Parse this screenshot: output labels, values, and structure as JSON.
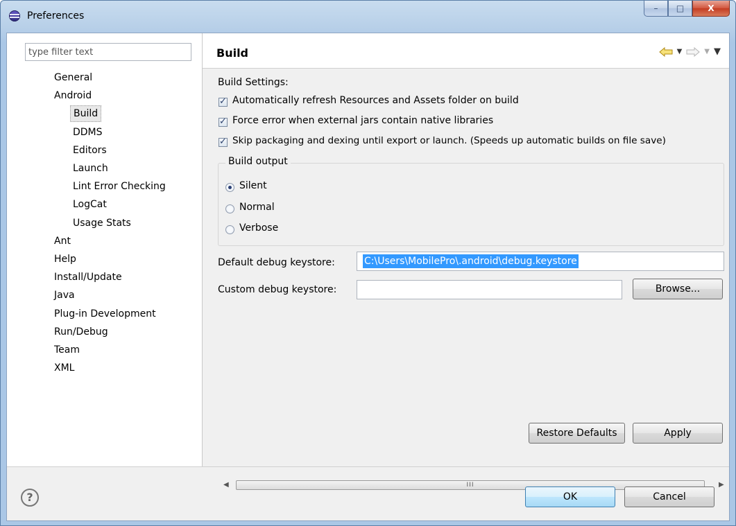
{
  "window": {
    "title": "Preferences",
    "minimize": "–",
    "maximize": "□",
    "close": "X"
  },
  "filter": {
    "placeholder": "type filter text"
  },
  "tree": [
    {
      "label": "General",
      "level": 0
    },
    {
      "label": "Android",
      "level": 0
    },
    {
      "label": "Build",
      "level": 1,
      "selected": true
    },
    {
      "label": "DDMS",
      "level": 1
    },
    {
      "label": "Editors",
      "level": 1
    },
    {
      "label": "Launch",
      "level": 1
    },
    {
      "label": "Lint Error Checking",
      "level": 1
    },
    {
      "label": "LogCat",
      "level": 1
    },
    {
      "label": "Usage Stats",
      "level": 1
    },
    {
      "label": "Ant",
      "level": 0
    },
    {
      "label": "Help",
      "level": 0
    },
    {
      "label": "Install/Update",
      "level": 0
    },
    {
      "label": "Java",
      "level": 0
    },
    {
      "label": "Plug-in Development",
      "level": 0
    },
    {
      "label": "Run/Debug",
      "level": 0
    },
    {
      "label": "Team",
      "level": 0
    },
    {
      "label": "XML",
      "level": 0
    }
  ],
  "page": {
    "title": "Build",
    "nav_icons": [
      "back-arrow-icon",
      "back-menu-icon",
      "forward-arrow-icon",
      "forward-menu-icon",
      "view-menu-icon"
    ],
    "settings_label": "Build Settings:",
    "checkboxes": [
      {
        "label": "Automatically refresh Resources and Assets folder on build",
        "checked": true
      },
      {
        "label": "Force error when external jars contain native libraries",
        "checked": true
      },
      {
        "label": "Skip packaging and dexing until export or launch. (Speeds up automatic builds on file save)",
        "checked": true
      }
    ],
    "output_group": {
      "title": "Build output",
      "options": [
        {
          "label": "Silent",
          "selected": true
        },
        {
          "label": "Normal",
          "selected": false
        },
        {
          "label": "Verbose",
          "selected": false
        }
      ]
    },
    "default_keystore_label": "Default debug keystore:",
    "default_keystore_value": "C:\\Users\\MobilePro\\.android\\debug.keystore",
    "custom_keystore_label": "Custom debug keystore:",
    "custom_keystore_value": "",
    "browse_label": "Browse...",
    "restore_label": "Restore Defaults",
    "apply_label": "Apply",
    "scroll_grip": "III"
  },
  "footer": {
    "help_glyph": "?",
    "ok_label": "OK",
    "cancel_label": "Cancel"
  },
  "colors": {
    "selection": "#3399ff",
    "title_bar": "#b7cfe8",
    "close_button": "#c43c22"
  }
}
